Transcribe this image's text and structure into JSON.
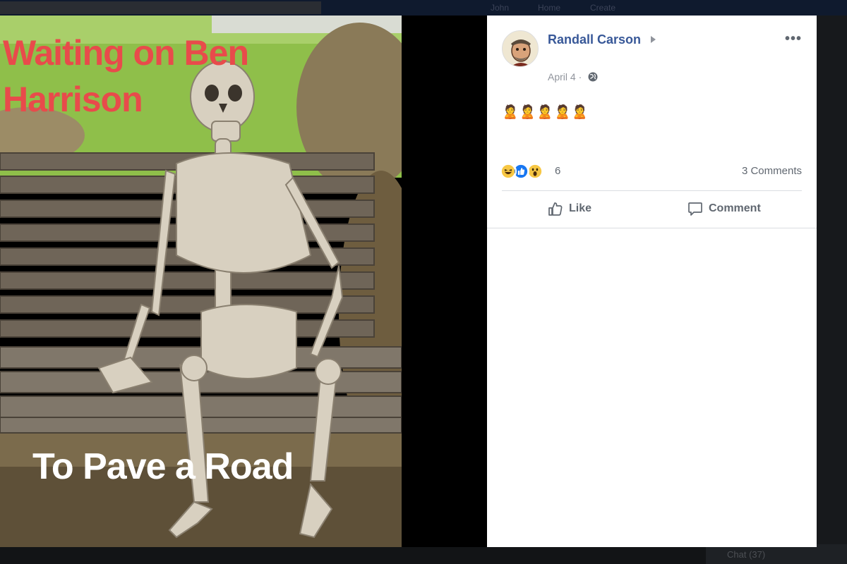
{
  "background": {
    "nav_items": [
      "John",
      "Home",
      "Create"
    ],
    "chat_label": "Chat (37)"
  },
  "photo": {
    "top_caption": "Waiting on Ben Harrison",
    "bottom_caption": "To Pave a Road"
  },
  "post": {
    "author": "Randall Carson",
    "more_label": "•••",
    "date": "April 4 ·",
    "body_emojis": "🙎🙎🙎🙎🙎",
    "reactions": {
      "icons": [
        "haha-icon",
        "like-icon",
        "wow-icon"
      ],
      "count": "6"
    },
    "comments_count": "3 Comments",
    "actions": {
      "like": "Like",
      "comment": "Comment"
    }
  },
  "colors": {
    "author_link": "#385898",
    "meme_red": "#e84b4b",
    "like_blue": "#1877f2",
    "reaction_yellow": "#f7c744"
  }
}
